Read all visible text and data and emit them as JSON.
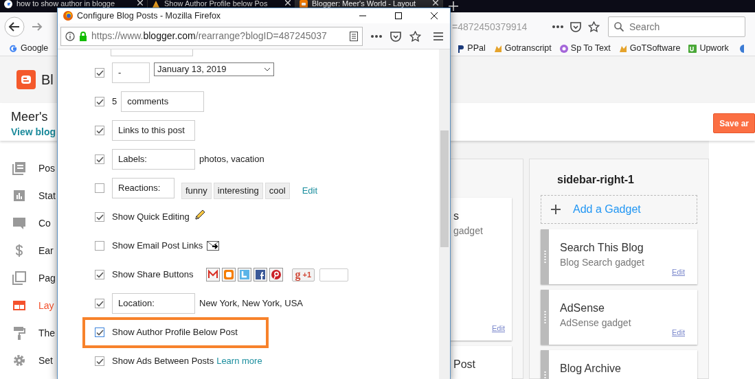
{
  "browser": {
    "tabs": [
      {
        "title": "how to show author in blogge",
        "selected": false
      },
      {
        "title": "Show Author Profile below Pos",
        "selected": false
      },
      {
        "title": "Blogger: Meer's World - Layout",
        "selected": true
      }
    ],
    "address": "=4872450379914",
    "search_placeholder": "Search",
    "bookmarks": [
      {
        "label": "Google"
      },
      {
        "label": "PPal"
      },
      {
        "label": "Gotranscript"
      },
      {
        "label": "Sp To Text"
      },
      {
        "label": "GoTSoftware"
      },
      {
        "label": "Upwork"
      }
    ]
  },
  "blogger": {
    "brand": "Bl",
    "blog_title": "Meer's",
    "view_blog": "View blog",
    "save_button": "Save ar",
    "nav": [
      {
        "label": "Pos",
        "selected": false
      },
      {
        "label": "Stat",
        "selected": false
      },
      {
        "label": "Co",
        "selected": false
      },
      {
        "label": "Ear",
        "selected": false
      },
      {
        "label": "Pag",
        "selected": false
      },
      {
        "label": "Lay",
        "selected": true
      },
      {
        "label": "The",
        "selected": false
      },
      {
        "label": "Set",
        "selected": false
      }
    ],
    "partial_column": [
      {
        "title": "s",
        "subtitle": "gadget",
        "edit": "Edit"
      },
      {
        "title": "Post"
      }
    ],
    "sidebar": {
      "title": "sidebar-right-1",
      "add_gadget": "Add a Gadget",
      "gadgets": [
        {
          "title": "Search This Blog",
          "subtitle": "Blog Search gadget",
          "edit": "Edit"
        },
        {
          "title": "AdSense",
          "subtitle": "AdSense gadget",
          "edit": "Edit"
        },
        {
          "title": "Blog Archive"
        }
      ]
    }
  },
  "popup": {
    "title": "Configure Blog Posts - Mozilla Firefox",
    "url_start": "https://www.",
    "url_domain": "blogger.com",
    "url_path": "/rearrange?blogID=487245037",
    "rows": [
      {
        "kind": "date",
        "checked": true,
        "highlighted": false,
        "field": "-",
        "select": "January 13, 2019"
      },
      {
        "kind": "field",
        "checked": true,
        "highlighted": false,
        "prefix": "5",
        "field": "comments"
      },
      {
        "kind": "field",
        "checked": true,
        "highlighted": false,
        "field": "Links to this post"
      },
      {
        "kind": "field",
        "checked": true,
        "highlighted": false,
        "field": "Labels:",
        "suffix": "photos, vacation"
      },
      {
        "kind": "reactions",
        "checked": false,
        "highlighted": false,
        "field": "Reactions:",
        "tags": [
          "funny",
          "interesting",
          "cool"
        ],
        "link": "Edit"
      },
      {
        "kind": "pencil",
        "checked": true,
        "highlighted": false,
        "label": "Show Quick Editing"
      },
      {
        "kind": "email",
        "checked": false,
        "highlighted": false,
        "label": "Show Email Post Links"
      },
      {
        "kind": "share",
        "checked": true,
        "highlighted": false,
        "label": "Show Share Buttons",
        "plus_g": "g",
        "plus_one": "+1"
      },
      {
        "kind": "field",
        "checked": true,
        "highlighted": false,
        "field": "Location:",
        "suffix": "New York, New York, USA"
      },
      {
        "kind": "option",
        "checked": true,
        "highlighted": true,
        "label": "Show Author Profile Below Post"
      },
      {
        "kind": "option",
        "checked": true,
        "highlighted": false,
        "label": "Show Ads Between Posts",
        "link": "Learn more"
      }
    ]
  }
}
